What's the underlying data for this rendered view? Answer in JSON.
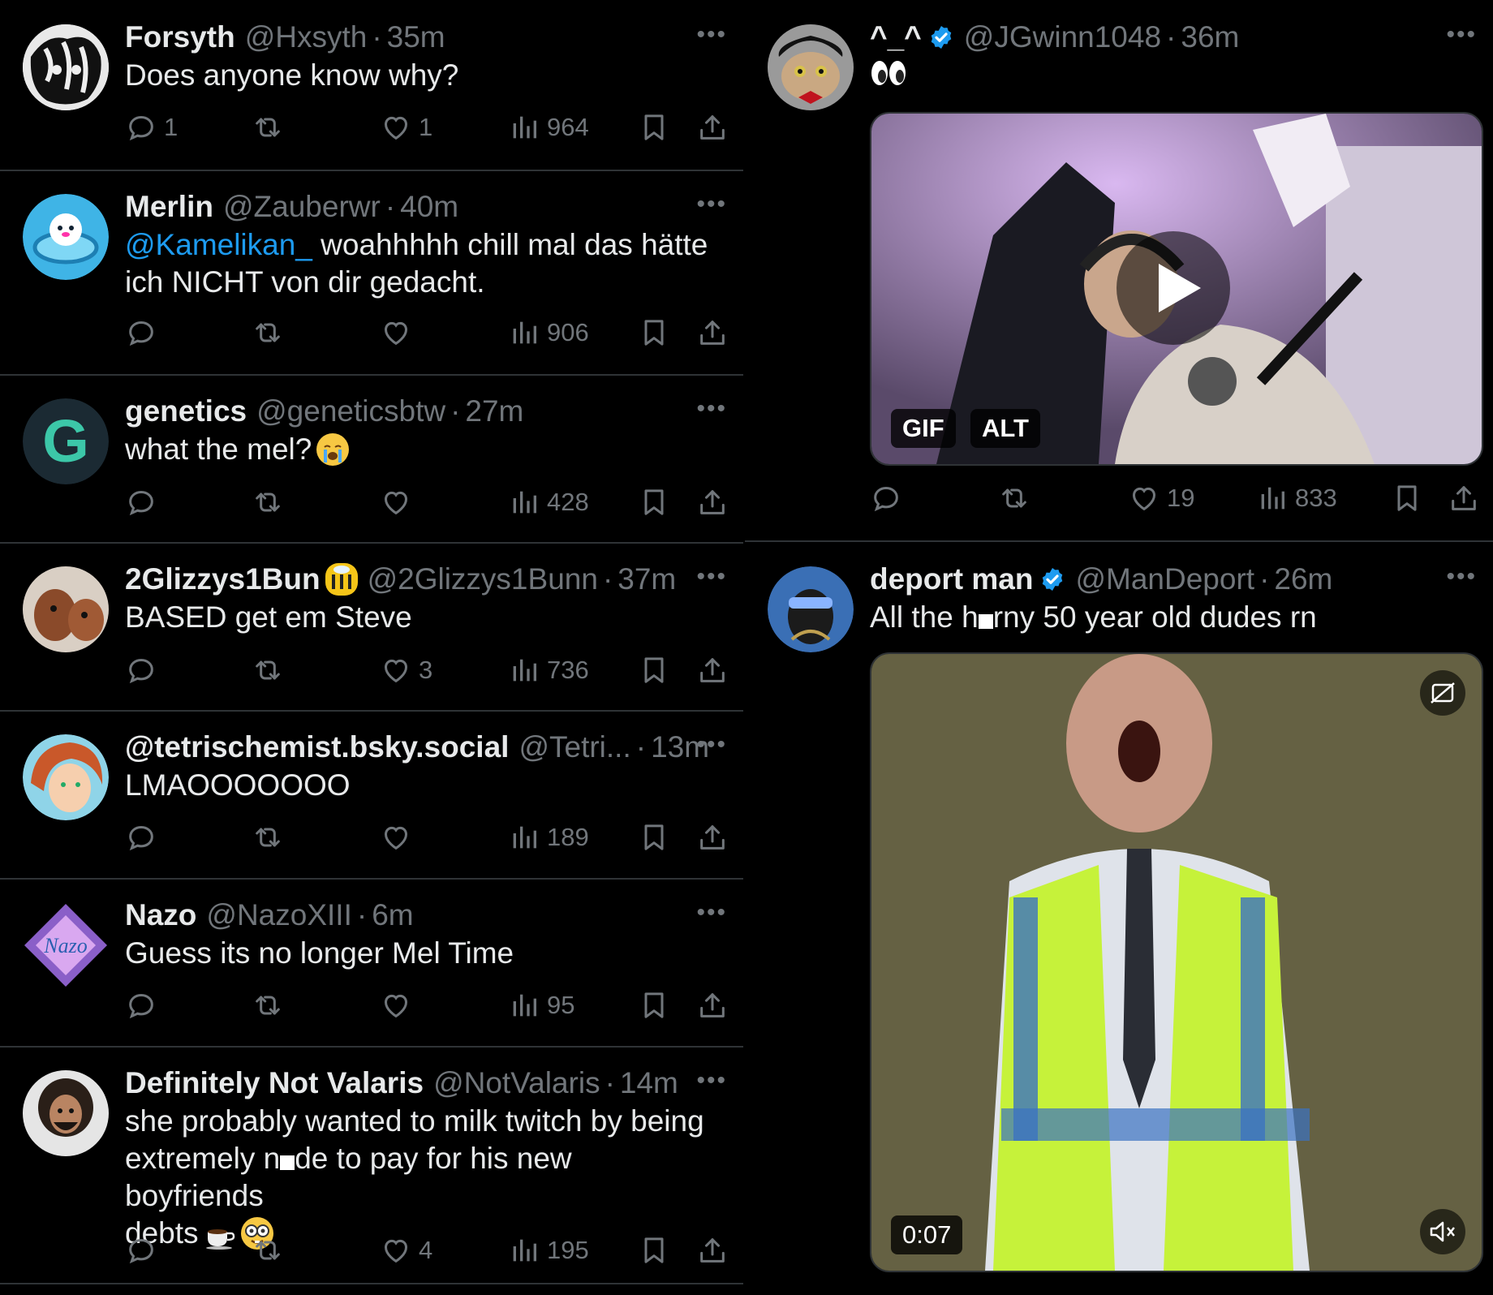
{
  "left_tweets": [
    {
      "name": "Forsyth",
      "handle": "@Hxsyth",
      "time": "35m",
      "text": "Does anyone know why?",
      "replies": "1",
      "retweets": "",
      "likes": "1",
      "views": "964"
    },
    {
      "name": "Merlin",
      "handle": "@Zauberwr",
      "time": "40m",
      "mention": "@Kamelikan_",
      "text_after": " woahhhhh chill mal das hätte ich NICHT von dir gedacht.",
      "replies": "",
      "retweets": "",
      "likes": "",
      "views": "906"
    },
    {
      "name": "genetics",
      "handle": "@geneticsbtw",
      "time": "27m",
      "text": "what the mel?",
      "emoji": "loudly-crying-face",
      "replies": "",
      "retweets": "",
      "likes": "",
      "views": "428"
    },
    {
      "name": "2Glizzys1Bun",
      "name_emoji": "bee",
      "handle": "@2Glizzys1Bunn",
      "time": "37m",
      "text": "BASED get em Steve",
      "replies": "",
      "retweets": "",
      "likes": "3",
      "views": "736"
    },
    {
      "name": "@tetrischemist.bsky.social",
      "handle": "@Tetri...",
      "time": "13m",
      "text": "LMAOOOOOOO",
      "replies": "",
      "retweets": "",
      "likes": "",
      "views": "189"
    },
    {
      "name": "Nazo",
      "handle": "@NazoXIII",
      "time": "6m",
      "text": "Guess its no longer Mel Time",
      "avatar_label": "Nazo",
      "replies": "",
      "retweets": "",
      "likes": "",
      "views": "95"
    },
    {
      "name": "Definitely Not Valaris",
      "handle": "@NotValaris",
      "time": "14m",
      "text_line1": "she probably wanted to milk twitch by being",
      "text_line2_a": "extremely n",
      "text_line2_b": "de to pay for his new boyfriends",
      "text_line3": "debts",
      "emojis": [
        "hot-beverage",
        "nerd-face"
      ],
      "replies": "",
      "retweets": "",
      "likes": "4",
      "views": "195"
    }
  ],
  "right_tweets": [
    {
      "name": "^_^",
      "verified": true,
      "handle": "@JGwinn1048",
      "time": "36m",
      "text_emoji": "eyes",
      "media_badges": [
        "GIF",
        "ALT"
      ],
      "replies": "",
      "retweets": "",
      "likes": "19",
      "views": "833"
    },
    {
      "name": "deport man",
      "verified": true,
      "handle": "@ManDeport",
      "time": "26m",
      "text_a": "All the h",
      "text_b": "rny 50 year old dudes rn",
      "video_time": "0:07"
    }
  ],
  "colors": {
    "background": "#000000",
    "text": "#e7e9ea",
    "muted": "#71767b",
    "link": "#1d9bf0",
    "divider": "#2f3336",
    "verified": "#1d9bf0"
  },
  "icons": [
    "reply-icon",
    "retweet-icon",
    "like-icon",
    "views-icon",
    "bookmark-icon",
    "share-icon",
    "more-icon",
    "play-icon",
    "mute-icon",
    "fullscreen-icon",
    "verified-badge-icon"
  ]
}
